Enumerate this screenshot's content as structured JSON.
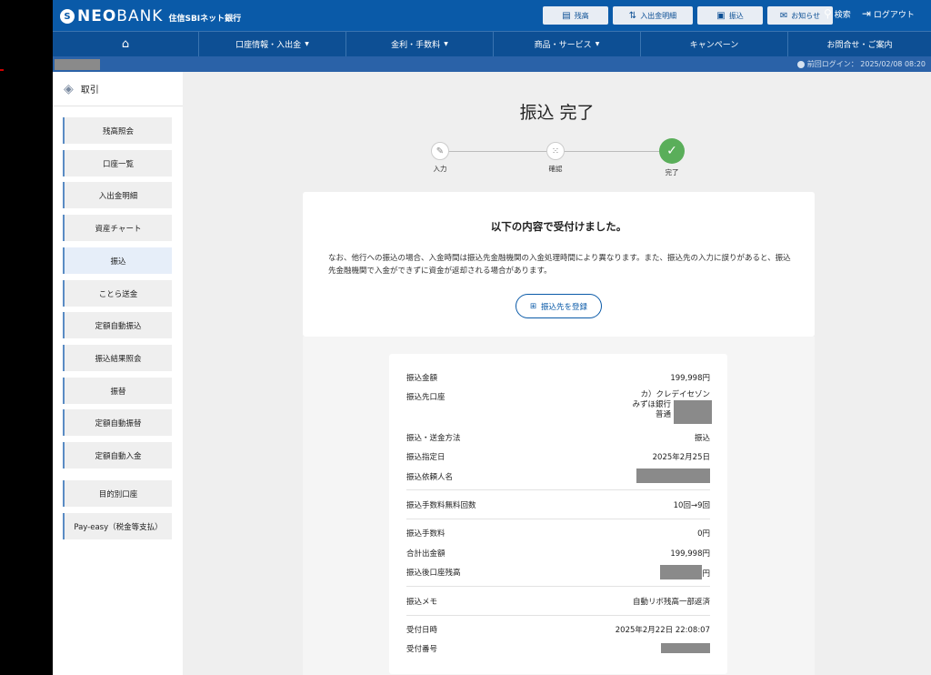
{
  "header": {
    "logo_neo": "NEO",
    "logo_bank": "BANK",
    "logo_sub": "住信SBIネット銀行",
    "top_buttons": [
      "残高",
      "入出金明細",
      "振込",
      "お知らせ"
    ],
    "search_label": "検索",
    "logout_label": "ログアウト",
    "last_login": "前回ログイン： 2025/02/08 08:20"
  },
  "nav": {
    "items": [
      "口座情報・入出金",
      "金利・手数料",
      "商品・サービス",
      "キャンペーン",
      "お問合せ・ご案内"
    ]
  },
  "sidebar": {
    "title": "取引",
    "items": [
      "残高照会",
      "口座一覧",
      "入出金明細",
      "資産チャート",
      "振込",
      "ことら送金",
      "定額自動振込",
      "振込結果照会",
      "振替",
      "定額自動振替",
      "定額自動入金",
      "目的別口座",
      "Pay-easy（税金等支払）"
    ]
  },
  "page": {
    "title": "振込 完了",
    "steps": [
      "入力",
      "確認",
      "完了"
    ]
  },
  "notice": {
    "heading": "以下の内容で受付けました。",
    "body": "なお、他行への振込の場合、入金時間は振込先金融機関の入金処理時間により異なります。また、振込先の入力に誤りがあると、振込先金融機関で入金ができずに資金が返却される場合があります。",
    "register_button": "振込先を登録"
  },
  "details": {
    "amount_label": "振込金額",
    "amount": "199,998円",
    "dest_label": "振込先口座",
    "dest_name": "カ）クレデイセゾン",
    "dest_bank": "みずほ銀行",
    "dest_type": "普通",
    "method_label": "振込・送金方法",
    "method": "振込",
    "date_label": "振込指定日",
    "date": "2025年2月25日",
    "requester_label": "振込依頼人名",
    "free_label": "振込手数料無料回数",
    "free": "10回→9回",
    "fee_label": "振込手数料",
    "fee": "0円",
    "total_label": "合計出金額",
    "total": "199,998円",
    "balance_label": "振込後口座残高",
    "balance_suffix": "円",
    "memo_label": "振込メモ",
    "memo": "自動リボ残高一部返済",
    "received_label": "受付日時",
    "received": "2025年2月22日 22:08:07",
    "receipt_label": "受付番号"
  }
}
